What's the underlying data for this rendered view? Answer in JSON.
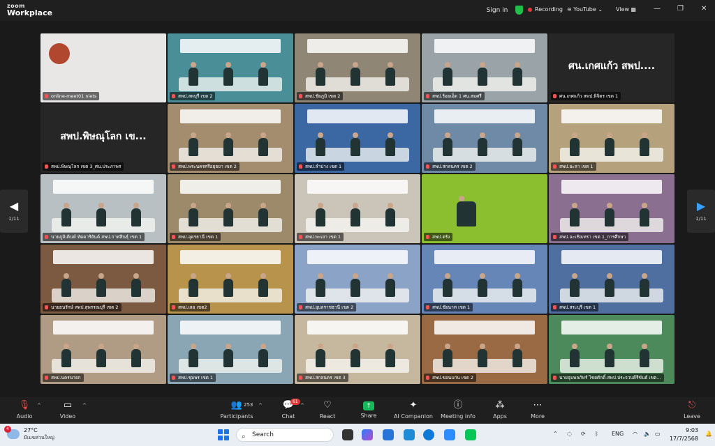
{
  "app": {
    "logo_line1": "zoom",
    "logo_line2": "Workplace",
    "sign_in": "Sign in",
    "recording": "Recording",
    "youtube": "YouTube",
    "view": "View",
    "minimize": "—",
    "restore": "❐",
    "close": "✕"
  },
  "gallery": {
    "page_left": "1/11",
    "page_right": "1/11",
    "tiles": [
      {
        "caption": "online-meet01 niets",
        "bigname": "",
        "color": "#e9e7e6",
        "kind": "logo",
        "active": true
      },
      {
        "caption": "สพป.ลพบุรี เขต 2",
        "bigname": "",
        "color": "#4a8f98",
        "kind": "room"
      },
      {
        "caption": "สพป.ชัยภูมิ เขต 2",
        "bigname": "",
        "color": "#8f8675",
        "kind": "room"
      },
      {
        "caption": "สพป.ร้อยเอ็ด 1 ศน.สมศรี",
        "bigname": "",
        "color": "#9aa4a8",
        "kind": "room"
      },
      {
        "caption": "ศน.เกศแก้ว สพป.พิจิตร เขต 1",
        "bigname": "ศน.เกศแก้ว สพป....",
        "color": "#262626",
        "kind": "name"
      },
      {
        "caption": "สพป.พิษณุโลก เขต 3_ศน.ประภาพร",
        "bigname": "สพป.พิษณุโลก เข...",
        "color": "#262626",
        "kind": "name"
      },
      {
        "caption": "สพป.พระนครศรีอยุธยา เขต 2",
        "bigname": "",
        "color": "#a48c6f",
        "kind": "room"
      },
      {
        "caption": "สพป.ลำปาง เขต 1",
        "bigname": "",
        "color": "#3b67a3",
        "kind": "room"
      },
      {
        "caption": "สพป.สกลนคร เขต 2",
        "bigname": "",
        "color": "#6f8aa6",
        "kind": "room"
      },
      {
        "caption": "สพป.ยะลา เขต 1",
        "bigname": "",
        "color": "#b5a27d",
        "kind": "room"
      },
      {
        "caption": "นายภูมิเดินท์ ทัดดาริยันต์ สพป.กาฬสินธุ์ เขต 1",
        "bigname": "",
        "color": "#b8c0c4",
        "kind": "room"
      },
      {
        "caption": "สพป.อุดรธานี เขต 1",
        "bigname": "",
        "color": "#9d8a6b",
        "kind": "room"
      },
      {
        "caption": "สพป.พะเยา เขต 1",
        "bigname": "",
        "color": "#cbc4b8",
        "kind": "room"
      },
      {
        "caption": "สพป.ตรัง",
        "bigname": "",
        "color": "#8cbf2f",
        "kind": "person"
      },
      {
        "caption": "สพป.ฉะเชิงเทรา เขต 1_การศึกษา",
        "bigname": "",
        "color": "#8a6f91",
        "kind": "room"
      },
      {
        "caption": "นายธนรักษ์ สพป.สุพรรณบุรี เขต 2",
        "bigname": "",
        "color": "#7c5a41",
        "kind": "room"
      },
      {
        "caption": "สพป.เลย เขต2",
        "bigname": "",
        "color": "#b7934c",
        "kind": "room"
      },
      {
        "caption": "สพป.อุบลราชธานี เขต 2",
        "bigname": "",
        "color": "#8aa3c6",
        "kind": "room"
      },
      {
        "caption": "สพป.ชัยนาท เขต 1",
        "bigname": "",
        "color": "#6786b8",
        "kind": "room"
      },
      {
        "caption": "สพป.สระบุรี เขต 1",
        "bigname": "",
        "color": "#4f6fa0",
        "kind": "room"
      },
      {
        "caption": "สพป.นครนายก",
        "bigname": "",
        "color": "#b09b84",
        "kind": "room"
      },
      {
        "caption": "สพป.ชุมพร เขต 1",
        "bigname": "",
        "color": "#8aa6b5",
        "kind": "room"
      },
      {
        "caption": "สพป.สกลนคร เขต 3",
        "bigname": "",
        "color": "#c5b89f",
        "kind": "room"
      },
      {
        "caption": "สพป.ขอนแก่น เขต 2",
        "bigname": "",
        "color": "#9a6a45",
        "kind": "room"
      },
      {
        "caption": "นายจุมพลภัทร์ ไชยศักดิ์-สพป.ประจวบคีรีขันธ์ เขต...",
        "bigname": "",
        "color": "#4d8a5b",
        "kind": "room"
      }
    ]
  },
  "toolbar": {
    "audio": "Audio",
    "video": "Video",
    "participants": "Participants",
    "participant_count": "253",
    "chat": "Chat",
    "chat_badge": "61",
    "react": "React",
    "share": "Share",
    "ai_companion": "AI Companion",
    "meeting_info": "Meeting info",
    "apps": "Apps",
    "more": "More",
    "leave": "Leave"
  },
  "taskbar": {
    "temp": "27°C",
    "weather_desc": "มีเมฆส่วนใหญ่",
    "weather_badge": "4",
    "search": "Search",
    "lang": "ENG",
    "time": "9:03",
    "date": "17/7/2568"
  }
}
